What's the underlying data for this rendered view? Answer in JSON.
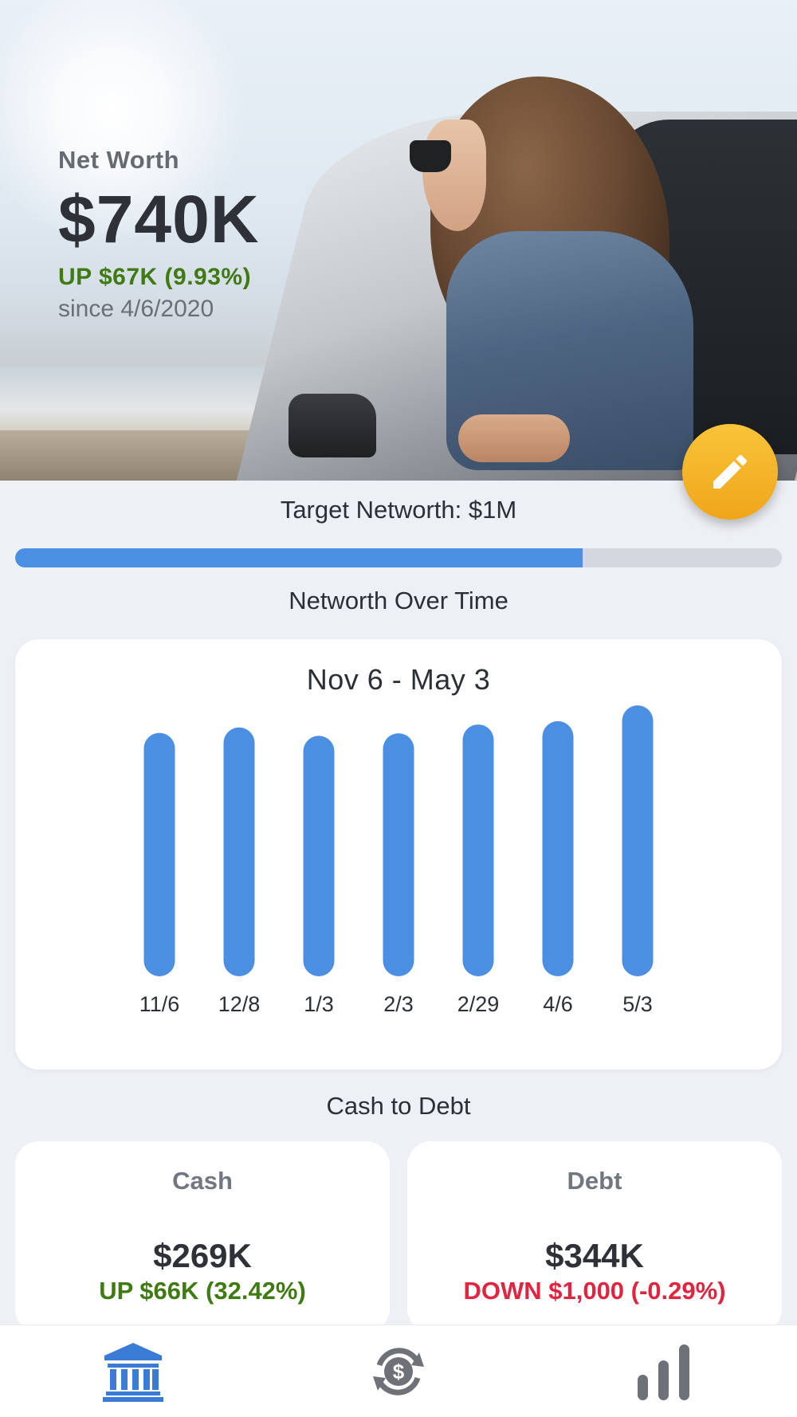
{
  "hero": {
    "label": "Net Worth",
    "value": "$740K",
    "change": "UP $67K (9.93%)",
    "since": "since 4/6/2020"
  },
  "edit_button": {
    "icon": "pencil-icon",
    "color": "#f5b52a"
  },
  "target": {
    "label": "Target Networth: $1M",
    "progress": 0.74
  },
  "networth_section": {
    "title": "Networth Over Time"
  },
  "chart_data": {
    "type": "bar",
    "title": "Nov 6 - May 3",
    "categories": [
      "11/6",
      "12/8",
      "1/3",
      "2/3",
      "2/29",
      "4/6",
      "5/3"
    ],
    "values": [
      665,
      680,
      657,
      664,
      688,
      697,
      740
    ],
    "ylim": [
      0,
      760
    ],
    "grid": false,
    "bar_color": "#4a8fe2"
  },
  "cash_to_debt": {
    "title": "Cash to Debt",
    "cash": {
      "title": "Cash",
      "value": "$269K",
      "change": "UP $66K (32.42%)"
    },
    "debt": {
      "title": "Debt",
      "value": "$344K",
      "change": "DOWN $1,000 (-0.29%)"
    }
  },
  "tabbar": {
    "items": [
      {
        "icon": "bank-icon",
        "active": true
      },
      {
        "icon": "cash-cycle-icon",
        "active": false
      },
      {
        "icon": "bar-chart-icon",
        "active": false
      }
    ],
    "active_color": "#3a7bd5",
    "inactive_color": "#6e7177"
  }
}
